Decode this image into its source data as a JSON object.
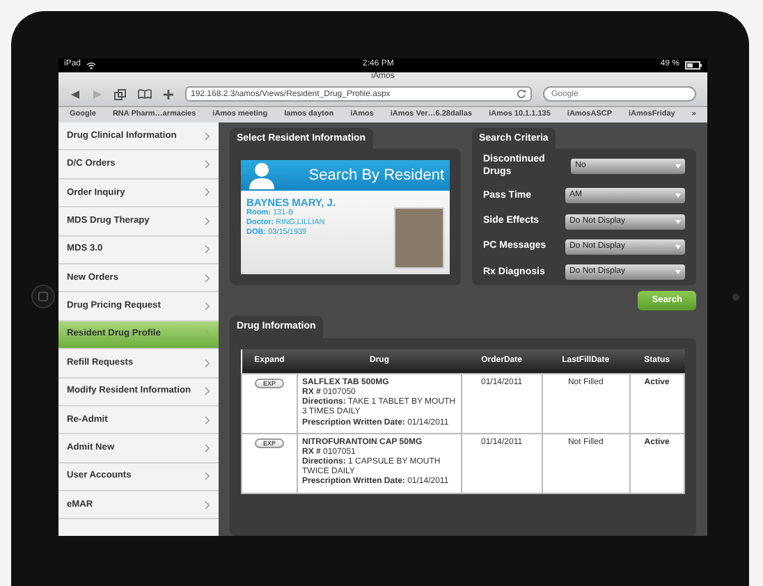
{
  "status_bar": {
    "device": "iPad",
    "time": "2:46 PM",
    "battery": "49 %"
  },
  "browser": {
    "title": "iAmos",
    "url": "192.168.2.3/iamos/Views/Resident_Drug_Profile.aspx",
    "search_placeholder": "Google",
    "bookmarks": [
      "Google",
      "RNA Pharm…armacies",
      "iAmos meeting",
      "Iamos dayton",
      "iAmos",
      "iAmos Ver…6.28dallas",
      "iAmos 10.1.1.135",
      "iAmosASCP",
      "iAmosFriday"
    ],
    "more": "»"
  },
  "sidebar": {
    "items": [
      {
        "label": "Drug Clinical Information",
        "selected": false
      },
      {
        "label": "D/C Orders",
        "selected": false
      },
      {
        "label": "Order Inquiry",
        "selected": false
      },
      {
        "label": "MDS Drug Therapy",
        "selected": false
      },
      {
        "label": "MDS 3.0",
        "selected": false
      },
      {
        "label": "New Orders",
        "selected": false
      },
      {
        "label": "Drug Pricing Request",
        "selected": false
      },
      {
        "label": "Resident Drug Profile",
        "selected": true
      },
      {
        "label": "Refill Requests",
        "selected": false
      },
      {
        "label": "Modify Resident Information",
        "selected": false
      },
      {
        "label": "Re-Admit",
        "selected": false
      },
      {
        "label": "Admit New",
        "selected": false
      },
      {
        "label": "User Accounts",
        "selected": false
      },
      {
        "label": "eMAR",
        "selected": false
      }
    ]
  },
  "resident_panel": {
    "title": "Select Resident Information",
    "card_title": "Search By Resident",
    "name": "BAYNES MARY, J.",
    "details": [
      "**Room:** 131-B",
      "**Doctor:** RING,LILLIAN",
      "**DOB:** 03/15/1939"
    ]
  },
  "criteria_panel": {
    "title": "Search Criteria",
    "fields": [
      {
        "label": "Discontinued Drugs",
        "value": "No"
      },
      {
        "label": "Pass Time",
        "value": "AM"
      },
      {
        "label": "Side Effects",
        "value": "Do Not Display"
      },
      {
        "label": "PC Messages",
        "value": "Do Not Display"
      },
      {
        "label": "Rx Diagnosis",
        "value": "Do Not Display"
      }
    ]
  },
  "search_button": "Search",
  "drug_panel": {
    "title": "Drug Information",
    "columns": [
      "Expand",
      "Drug",
      "OrderDate",
      "LastFillDate",
      "Status"
    ],
    "rows": [
      {
        "expand": "EXP",
        "drug": "SALFLEX TAB 500MG",
        "lines": [
          "**RX #** 0107050",
          "**Directions:** TAKE 1 TABLET BY MOUTH 3 TIMES DAILY",
          "**Prescription Written Date:** 01/14/2011"
        ],
        "order_date": "01/14/2011",
        "last_fill": "Not Filled",
        "status": "Active"
      },
      {
        "expand": "EXP",
        "drug": "NITROFURANTOIN CAP 50MG",
        "lines": [
          "**RX #** 0107051",
          "**Directions:** 1 CAPSULE BY MOUTH TWICE DAILY",
          "**Prescription Written Date:** 01/14/2011"
        ],
        "order_date": "01/14/2011",
        "last_fill": "Not Filled",
        "status": "Active"
      }
    ]
  }
}
